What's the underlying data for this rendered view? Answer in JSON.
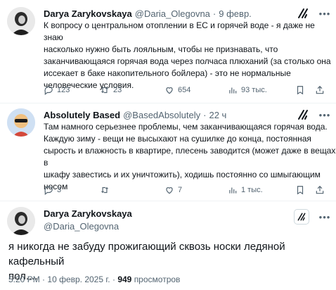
{
  "reply1": {
    "name": "Darya Zarykovskaya",
    "handle": "@Daria_Olegovna",
    "separator": "·",
    "time": "9 февр.",
    "lines": [
      "К вопросу о центральном отоплении в ЕС и горячей воде - я даже не знаю",
      "насколько нужно быть лояльным, чтобы не признавать, что",
      "заканчивающаяся горячая вода через полчаса плюханий (за столько она",
      "иссекает в баке накопительного бойлера) - это не нормальные",
      "человеческие условия."
    ],
    "replies": "123",
    "reposts": "23",
    "likes": "654",
    "views": "93 тыс."
  },
  "reply2": {
    "name": "Absolutely Based",
    "handle": "@BasedAbsolutely",
    "separator": "·",
    "time": "22 ч",
    "lines": [
      "Там намного серьезнее проблемы, чем заканчивающаяся горячая вода.",
      "Каждую зиму - вещи не высыхают на сушилке до конца, постоянная",
      "сырость и влажность в квартире, плесень заводится (может даже в вещах в",
      "шкафу завестись и их уничтожить), ходишь постоянно со шмыгающим",
      "носом"
    ],
    "replies": "3",
    "reposts": "",
    "likes": "7",
    "views": "1 тыс."
  },
  "main": {
    "name": "Darya Zarykovskaya",
    "handle": "@Daria_Olegovna",
    "lines": [
      "я никогда не забуду прожигающий сквозь носки ледяной кафельный",
      "пол...."
    ],
    "time": "5:20 PM",
    "date": "10 февр. 2025 г.",
    "dot": "·",
    "views_count": "949",
    "views_label": "просмотров"
  },
  "icons": {
    "grok": "grok-icon",
    "more": "more-icon",
    "reply": "reply-icon",
    "repost": "repost-icon",
    "like": "like-icon",
    "views": "views-icon",
    "bookmark": "bookmark-icon",
    "share": "share-icon"
  }
}
